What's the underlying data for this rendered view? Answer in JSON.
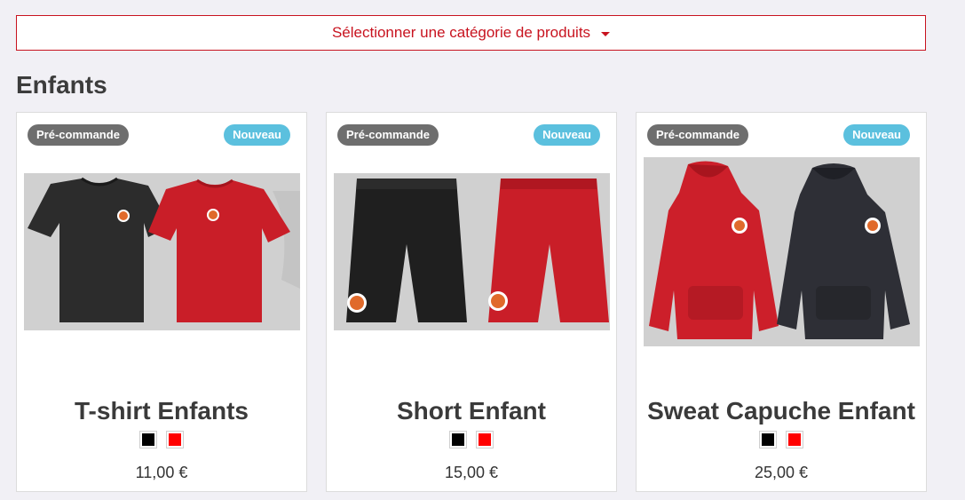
{
  "category_select": {
    "label": "Sélectionner une catégorie de produits"
  },
  "section": {
    "title": "Enfants"
  },
  "colors": {
    "black": "#000000",
    "red": "#ff0000",
    "accent": "#c8131f",
    "badge_new": "#5bc0de",
    "badge_pre": "#6e6e6e"
  },
  "products": [
    {
      "badge_pre": "Pré-commande",
      "badge_new": "Nouveau",
      "title": "T-shirt Enfants",
      "price": "11,00 €",
      "swatches": [
        "black",
        "red"
      ],
      "image": "tshirt-image"
    },
    {
      "badge_pre": "Pré-commande",
      "badge_new": "Nouveau",
      "title": "Short Enfant",
      "price": "15,00 €",
      "swatches": [
        "black",
        "red"
      ],
      "image": "shorts-image"
    },
    {
      "badge_pre": "Pré-commande",
      "badge_new": "Nouveau",
      "title": "Sweat Capuche Enfant",
      "price": "25,00 €",
      "swatches": [
        "black",
        "red"
      ],
      "image": "hoodie-image"
    }
  ]
}
